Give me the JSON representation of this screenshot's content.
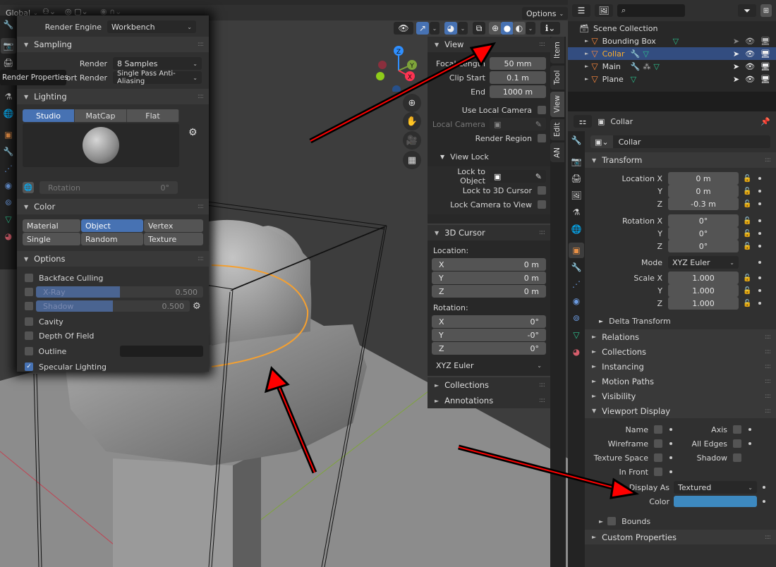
{
  "viewport_header": {
    "orientation": "Global",
    "options_label": "Options"
  },
  "tooltip": "Render Properties",
  "render_popup": {
    "render_engine_label": "Render Engine",
    "render_engine_value": "Workbench",
    "sampling": {
      "title": "Sampling",
      "render_label": "Render",
      "render_value": "8 Samples",
      "viewport_label": "Viewport Render",
      "viewport_value": "Single Pass Anti-Aliasing"
    },
    "lighting": {
      "title": "Lighting",
      "modes": [
        "Studio",
        "MatCap",
        "Flat"
      ],
      "active_mode": "Studio",
      "rotation_label": "Rotation",
      "rotation_value": "0°"
    },
    "color": {
      "title": "Color",
      "options": [
        "Material",
        "Object",
        "Vertex",
        "Single",
        "Random",
        "Texture"
      ],
      "active": "Object"
    },
    "options": {
      "title": "Options",
      "backface_culling": "Backface Culling",
      "xray_label": "X-Ray",
      "xray_value": "0.500",
      "xray_fraction": 0.5,
      "shadow_label": "Shadow",
      "shadow_value": "0.500",
      "shadow_fraction": 0.5,
      "cavity": "Cavity",
      "dof": "Depth Of Field",
      "outline": "Outline",
      "specular": "Specular Lighting",
      "specular_checked": true
    }
  },
  "gizmo": {
    "z": "Z",
    "y": "Y",
    "x": "X"
  },
  "npanel": {
    "view": {
      "title": "View",
      "focal_label": "Focal Length",
      "focal_value": "50 mm",
      "clip_start_label": "Clip Start",
      "clip_start_value": "0.1 m",
      "end_label": "End",
      "end_value": "1000 m",
      "use_local_camera": "Use Local Camera",
      "local_camera": "Local Camera",
      "render_region": "Render Region",
      "view_lock_title": "View Lock",
      "lock_to_object": "Lock to Object",
      "lock_3d_cursor": "Lock to 3D Cursor",
      "lock_camera_view": "Lock Camera to View"
    },
    "cursor": {
      "title": "3D Cursor",
      "location_label": "Location:",
      "location": [
        {
          "axis": "X",
          "value": "0 m"
        },
        {
          "axis": "Y",
          "value": "0 m"
        },
        {
          "axis": "Z",
          "value": "0 m"
        }
      ],
      "rotation_label": "Rotation:",
      "rotation": [
        {
          "axis": "X",
          "value": "0°"
        },
        {
          "axis": "Y",
          "value": "-0°"
        },
        {
          "axis": "Z",
          "value": "0°"
        }
      ],
      "mode": "XYZ Euler"
    },
    "collections": "Collections",
    "annotations": "Annotations",
    "tabs": [
      "Item",
      "Tool",
      "View",
      "Edit",
      "AN"
    ],
    "active_tab": "View"
  },
  "outliner": {
    "root": "Scene Collection",
    "items": [
      {
        "name": "Bounding Box",
        "selected": false
      },
      {
        "name": "Collar",
        "selected": true
      },
      {
        "name": "Main",
        "selected": false
      },
      {
        "name": "Plane",
        "selected": false
      }
    ]
  },
  "properties": {
    "object_name": "Collar",
    "name_field": "Collar",
    "transform": {
      "title": "Transform",
      "location_label": "Location X",
      "location": [
        "0 m",
        "0 m",
        "-0.3 m"
      ],
      "rotation_label": "Rotation X",
      "rotation": [
        "0°",
        "0°",
        "0°"
      ],
      "mode_label": "Mode",
      "mode_value": "XYZ Euler",
      "scale_label": "Scale X",
      "scale": [
        "1.000",
        "1.000",
        "1.000"
      ],
      "y": "Y",
      "z": "Z",
      "delta": "Delta Transform"
    },
    "sections": [
      "Relations",
      "Collections",
      "Instancing",
      "Motion Paths",
      "Visibility"
    ],
    "viewport_display": {
      "title": "Viewport Display",
      "name": "Name",
      "axis": "Axis",
      "wireframe": "Wireframe",
      "all_edges": "All Edges",
      "texture_space": "Texture Space",
      "shadow": "Shadow",
      "in_front": "In Front",
      "display_as_label": "Display As",
      "display_as_value": "Textured",
      "color_label": "Color",
      "color_value": "#3d89c0",
      "bounds": "Bounds"
    },
    "custom_properties": "Custom Properties"
  },
  "colors": {
    "accent": "#4772b3",
    "selection_orange": "#f5a030",
    "annotation_arrow": "#ff0000"
  }
}
